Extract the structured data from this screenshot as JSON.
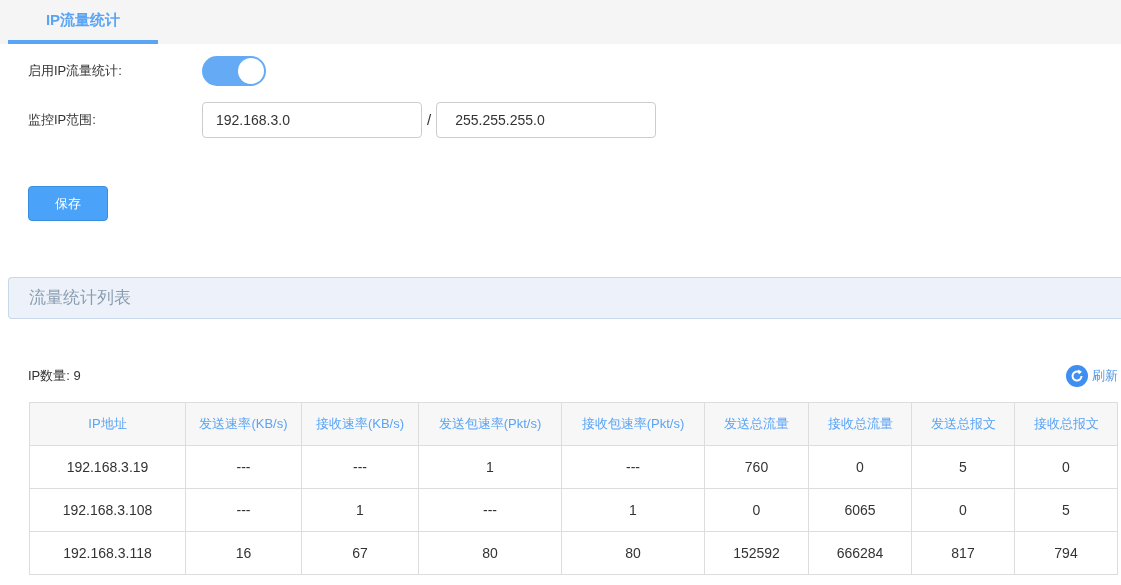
{
  "tabs": [
    {
      "label": "IP流量统计",
      "selected": true
    }
  ],
  "form": {
    "enable_label": "启用IP流量统计:",
    "enable_on": true,
    "range_label": "监控IP范围:",
    "ip_value": "192.168.3.0",
    "separator": "/",
    "mask_value": "255.255.255.0",
    "save_button": "保存"
  },
  "section": {
    "title": "流量统计列表"
  },
  "summary": {
    "count_label": "IP数量: 9",
    "refresh": "刷新"
  },
  "table": {
    "columns": [
      "IP地址",
      "发送速率(KB/s)",
      "接收速率(KB/s)",
      "发送包速率(Pkt/s)",
      "接收包速率(Pkt/s)",
      "发送总流量",
      "接收总流量",
      "发送总报文",
      "接收总报文"
    ],
    "rows": [
      [
        "192.168.3.19",
        "---",
        "---",
        "1",
        "---",
        "760",
        "0",
        "5",
        "0"
      ],
      [
        "192.168.3.108",
        "---",
        "1",
        "---",
        "1",
        "0",
        "6065",
        "0",
        "5"
      ],
      [
        "192.168.3.118",
        "16",
        "67",
        "80",
        "80",
        "152592",
        "666284",
        "817",
        "794"
      ]
    ]
  }
}
